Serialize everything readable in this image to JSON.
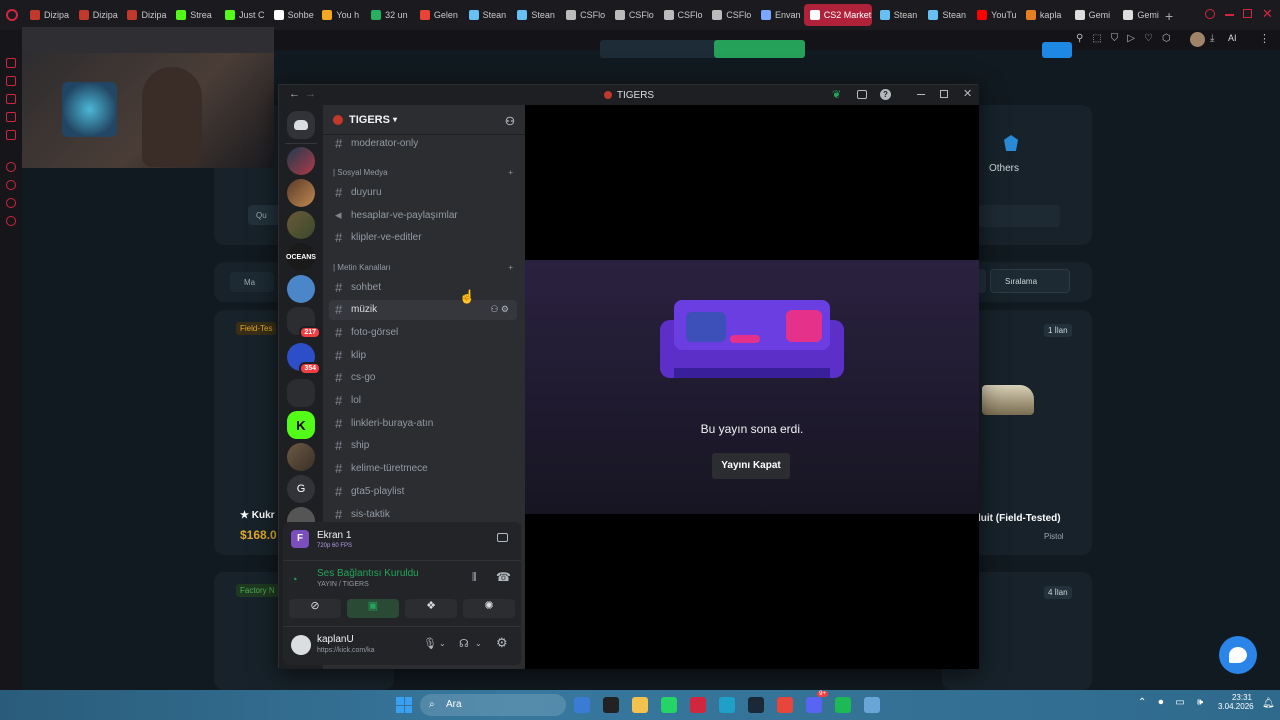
{
  "browser": {
    "tabs": [
      {
        "label": "Dizipa",
        "color": "#c0392b"
      },
      {
        "label": "Dizipa",
        "color": "#c0392b"
      },
      {
        "label": "Dizipa",
        "color": "#c0392b"
      },
      {
        "label": "Strea",
        "color": "#53fc18"
      },
      {
        "label": "Just C",
        "color": "#53fc18"
      },
      {
        "label": "Sohbe",
        "color": "#ffffff"
      },
      {
        "label": "You h",
        "color": "#f5a623"
      },
      {
        "label": "32 un",
        "color": "#27ae60"
      },
      {
        "label": "Gelen",
        "color": "#ea4335"
      },
      {
        "label": "Stean",
        "color": "#66c0f4"
      },
      {
        "label": "Stean",
        "color": "#66c0f4"
      },
      {
        "label": "CSFlo",
        "color": "#bbbbbb"
      },
      {
        "label": "CSFlo",
        "color": "#bbbbbb"
      },
      {
        "label": "CSFlo",
        "color": "#bbbbbb"
      },
      {
        "label": "CSFlo",
        "color": "#bbbbbb"
      },
      {
        "label": "Envan",
        "color": "#7aa7ff"
      },
      {
        "label": "CS2 Market",
        "color": "#ffffff",
        "active": true
      },
      {
        "label": "Stean",
        "color": "#66c0f4"
      },
      {
        "label": "Stean",
        "color": "#66c0f4"
      },
      {
        "label": "YouTu",
        "color": "#ff0000"
      },
      {
        "label": "kapla",
        "color": "#e67e22"
      },
      {
        "label": "Gemi",
        "color": "#dddddd"
      },
      {
        "label": "Gemi",
        "color": "#dddddd"
      }
    ],
    "ai_label": "AI"
  },
  "background_page": {
    "others_label": "Others",
    "sort_label": "Sıralama",
    "search_chip": "Qu",
    "filter_chip": "Ma",
    "tag1": "Field-Tes",
    "tag2": "Factory N",
    "listing1": "1 İlan",
    "listing2": "4 İlan",
    "item_left": "★ Kukr",
    "price_left": "$168.0",
    "item_right": "luit (Field-Tested)",
    "item_right_type": "Pistol"
  },
  "discord": {
    "window_title": "TIGERS",
    "server_name": "TIGERS",
    "channels_top": [
      "moderator-only"
    ],
    "cat_social": "| Sosyal Medya",
    "social_channels": [
      "duyuru",
      "hesaplar-ve-paylaşımlar",
      "klipler-ve-editler"
    ],
    "cat_text": "| Metin Kanalları",
    "text_channels": [
      "sohbet",
      "müzik",
      "foto-görsel",
      "klip",
      "cs-go",
      "lol",
      "linkleri-buraya-atın",
      "ship",
      "kelime-türetmece",
      "gta5-playlist",
      "sis-taktik"
    ],
    "server_badges": [
      "217",
      "354"
    ],
    "server_letter": "G",
    "stream_title": "Ekran 1",
    "stream_quality": "720p 60 FPS",
    "voice_status": "Ses Bağlantısı Kuruldu",
    "voice_channel": "YAYIN / TIGERS",
    "username": "kaplanU",
    "user_status": "https://kick.com/ka",
    "stream_ended": "Bu yayın sona erdi.",
    "close_stream": "Yayını Kapat"
  },
  "taskbar": {
    "search_placeholder": "Ara",
    "time": "23:31",
    "date": "3.04.2026",
    "discord_badge": "9+"
  },
  "colors": {
    "accent": "#5865f2",
    "green": "#23a55a",
    "opera_red": "#d2263f",
    "kick_green": "#53fc18"
  }
}
